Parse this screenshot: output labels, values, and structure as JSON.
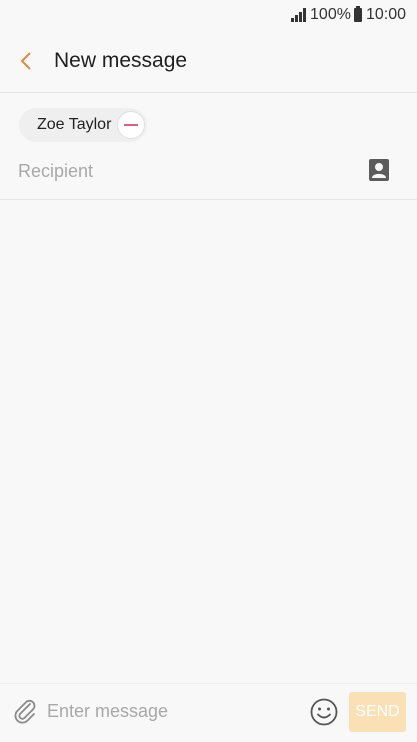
{
  "status_bar": {
    "battery": "100%",
    "time": "10:00",
    "icons": [
      "signal-icon",
      "battery-icon"
    ]
  },
  "header": {
    "back_icon": "back-chevron-icon",
    "title": "New message"
  },
  "recipients": {
    "chips": [
      {
        "name": "Zoe Taylor",
        "remove_icon": "remove-minus-icon"
      }
    ],
    "input_placeholder": "Recipient",
    "contacts_icon": "contact-picker-icon"
  },
  "composer": {
    "attach_icon": "paperclip-icon",
    "message_placeholder": "Enter message",
    "emoji_icon": "emoji-icon",
    "send_label": "SEND"
  },
  "colors": {
    "accent": "#e08a3c",
    "remove": "#e0607a",
    "send_disabled": "#fbe0b6",
    "background": "#f8f8f8"
  }
}
